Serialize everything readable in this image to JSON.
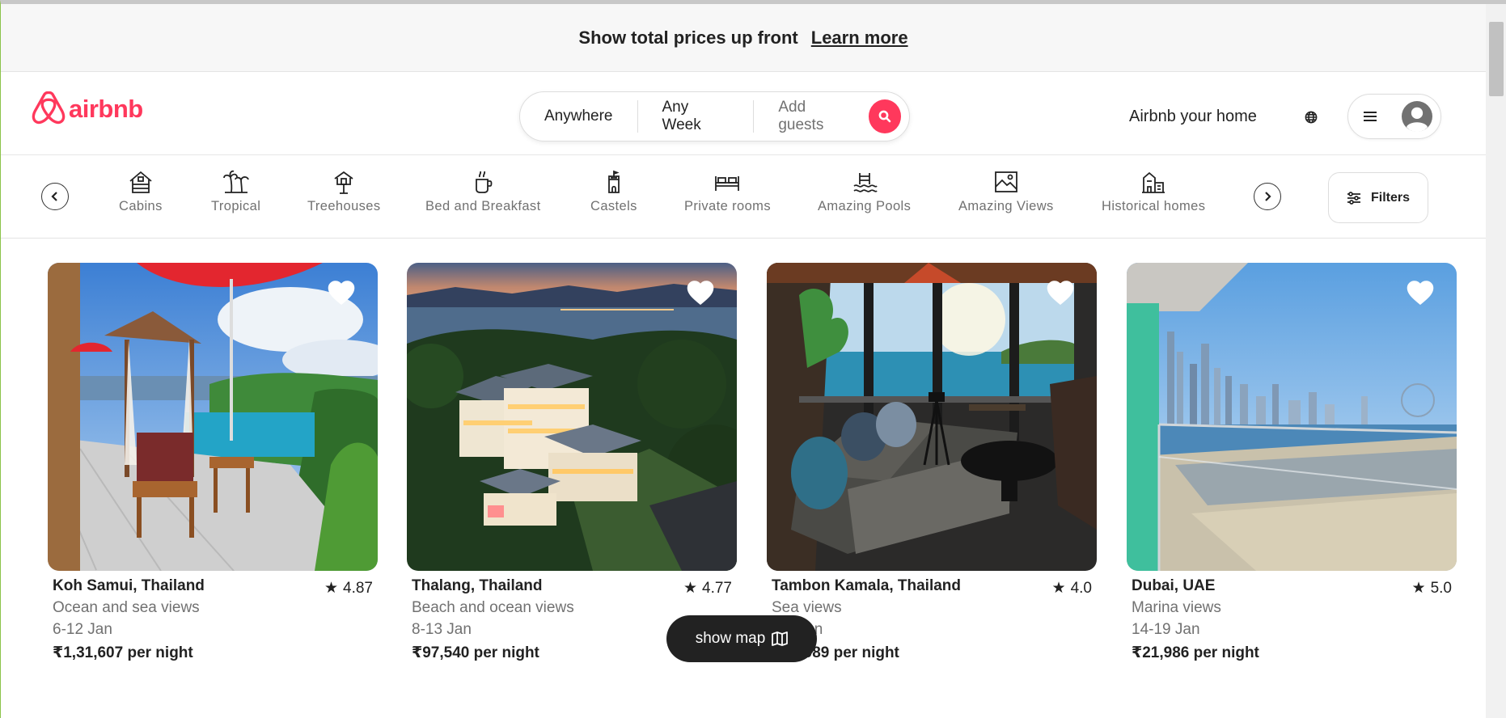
{
  "banner": {
    "text": "Show total prices up front",
    "link": "Learn more"
  },
  "header": {
    "logo_text": "airbnb",
    "search": {
      "where": "Anywhere",
      "when": "Any Week",
      "guests": "Add guests",
      "icon": "search-icon"
    },
    "host_link": "Airbnb your home",
    "globe_icon": "globe-icon",
    "menu_icon": "hamburger-icon",
    "avatar_icon": "user-avatar-icon"
  },
  "categories": {
    "items": [
      {
        "label": "Cabins",
        "icon": "cabin-icon"
      },
      {
        "label": "Tropical",
        "icon": "palm-tree-icon"
      },
      {
        "label": "Treehouses",
        "icon": "treehouse-icon"
      },
      {
        "label": "Bed and Breakfast",
        "icon": "coffee-cup-icon"
      },
      {
        "label": "Castels",
        "icon": "castle-icon"
      },
      {
        "label": "Private rooms",
        "icon": "bed-icon"
      },
      {
        "label": "Amazing Pools",
        "icon": "pool-icon"
      },
      {
        "label": "Amazing Views",
        "icon": "view-icon"
      },
      {
        "label": "Historical homes",
        "icon": "historical-home-icon"
      }
    ],
    "filters_label": "Filters"
  },
  "listings": [
    {
      "location": "Koh Samui, Thailand",
      "rating": "4.87",
      "description": "Ocean and sea views",
      "dates": "6-12 Jan",
      "price": "₹1,31,607 per night",
      "scene": "poolside-deck"
    },
    {
      "location": "Thalang, Thailand",
      "rating": "4.77",
      "description": "Beach and ocean views",
      "dates": "8-13 Jan",
      "price": "₹97,540 per night",
      "scene": "villa-night"
    },
    {
      "location": "Tambon Kamala, Thailand",
      "rating": "4.0",
      "description": "Sea views",
      "dates": "1-6 Jan",
      "price": "₹47,089 per night",
      "scene": "living-room"
    },
    {
      "location": "Dubai, UAE",
      "rating": "5.0",
      "description": "Marina views",
      "dates": "14-19 Jan",
      "price": "₹21,986 per night",
      "scene": "marina-skyline"
    }
  ],
  "show_map": {
    "label": "show map",
    "icon": "map-icon"
  },
  "colors": {
    "brand": "#ff385c",
    "text": "#222222",
    "muted": "#717171"
  }
}
